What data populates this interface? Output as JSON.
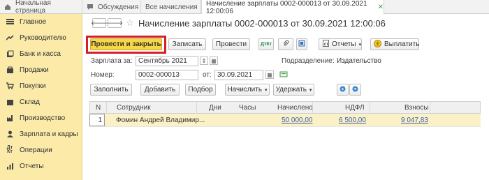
{
  "tabs": [
    {
      "label": "Начальная страница",
      "icon": "home-icon"
    },
    {
      "label": "Обсуждения",
      "icon": "chat-icon"
    },
    {
      "label": "Все начисления",
      "icon": ""
    },
    {
      "label": "Начисление зарплаты 0002-000013 от 30.09.2021 12:00:06",
      "icon": ""
    }
  ],
  "sidebar": {
    "items": [
      {
        "label": "Главное",
        "icon": "menu-icon"
      },
      {
        "label": "Руководителю",
        "icon": "trend-icon"
      },
      {
        "label": "Банк и касса",
        "icon": "bank-icon"
      },
      {
        "label": "Продажи",
        "icon": "sales-icon"
      },
      {
        "label": "Покупки",
        "icon": "cart-icon"
      },
      {
        "label": "Склад",
        "icon": "warehouse-icon"
      },
      {
        "label": "Производство",
        "icon": "factory-icon"
      },
      {
        "label": "Зарплата и кадры",
        "icon": "person-icon"
      },
      {
        "label": "Операции",
        "icon": "operations-icon"
      },
      {
        "label": "Отчеты",
        "icon": "chart-icon"
      }
    ]
  },
  "document": {
    "title": "Начисление зарплаты 0002-000013 от 30.09.2021 12:00:06"
  },
  "toolbar": {
    "post_close": "Провести и закрыть",
    "save": "Записать",
    "post": "Провести",
    "reports": "Отчеты",
    "pay": "Выплатить"
  },
  "form": {
    "salary_for_label": "Зарплата за:",
    "salary_for_value": "Сентябрь 2021",
    "subdivision_label": "Подразделение:",
    "subdivision_value": "Издательство",
    "number_label": "Номер:",
    "number_value": "0002-000013",
    "from_label": "от:",
    "from_value": "30.09.2021"
  },
  "grid_toolbar": {
    "fill": "Заполнить",
    "add": "Добавить",
    "select": "Подбор",
    "accrue": "Начислить",
    "withhold": "Удержать"
  },
  "table": {
    "columns": [
      "N",
      "Сотрудник",
      "Дни",
      "Часы",
      "Начислено",
      "НДФЛ",
      "Взносы"
    ],
    "rows": [
      {
        "n": "1",
        "employee": "Фомин Андрей Владимир...",
        "days": "",
        "hours": "",
        "accrued": "50 000,00",
        "ndfl": "6 500,00",
        "contributions": "9 047,83"
      }
    ]
  },
  "colors": {
    "sidebar_bg": "#fbeaa8",
    "primary_button": "#f7d743",
    "highlight_frame": "#d4202a",
    "row_selected": "#fbf1c7"
  }
}
